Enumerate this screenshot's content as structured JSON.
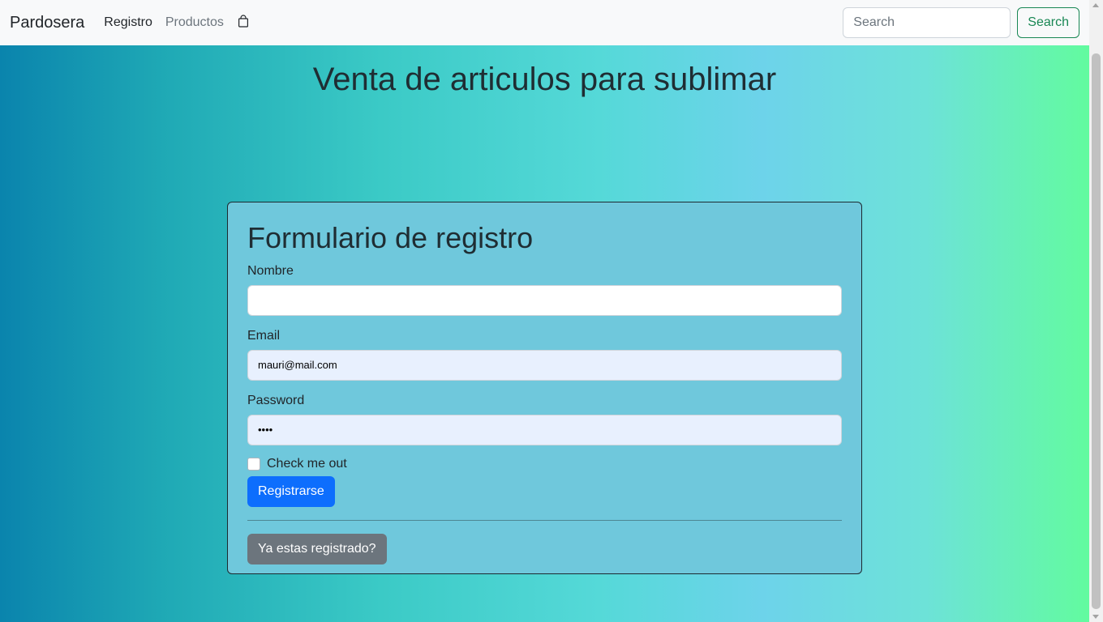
{
  "navbar": {
    "brand": "Pardosera",
    "links": [
      {
        "label": "Registro"
      },
      {
        "label": "Productos"
      }
    ],
    "cart_icon": "shopping-bag-icon",
    "search": {
      "placeholder": "Search",
      "value": "",
      "button_label": "Search"
    }
  },
  "main": {
    "title": "Venta de articulos para sublimar"
  },
  "form": {
    "title": "Formulario de registro",
    "name": {
      "label": "Nombre",
      "value": ""
    },
    "email": {
      "label": "Email",
      "value": "mauri@mail.com"
    },
    "password": {
      "label": "Password",
      "value": "••••"
    },
    "checkbox": {
      "label": "Check me out",
      "checked": false
    },
    "submit_label": "Registrarse",
    "login_label": "Ya estas registrado?"
  },
  "colors": {
    "primary": "#0d6efd",
    "secondary": "#6c757d",
    "success": "#198754",
    "card_bg": "#6fc8dc"
  }
}
